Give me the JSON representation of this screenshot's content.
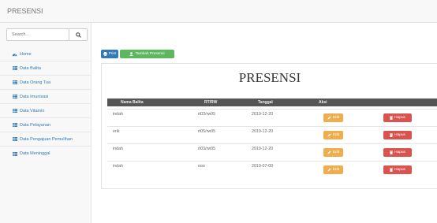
{
  "app": {
    "brand": "PRESENSI"
  },
  "search": {
    "placeholder": "Search..."
  },
  "sidebar": {
    "items": [
      {
        "label": "Home",
        "icon": "dashboard-icon"
      },
      {
        "label": "Data Balita",
        "icon": "table-icon"
      },
      {
        "label": "Data Orang Tua",
        "icon": "table-icon"
      },
      {
        "label": "Data Imunisasi",
        "icon": "table-icon"
      },
      {
        "label": "Data Vitamin",
        "icon": "table-icon"
      },
      {
        "label": "Data Pelayanan",
        "icon": "table-icon"
      },
      {
        "label": "Data Pengajuan Pemulihan",
        "icon": "table-icon"
      },
      {
        "label": "Data Meninggal",
        "icon": "table-icon"
      }
    ]
  },
  "toolbar": {
    "print_label": "Print",
    "add_label": "Tambah Presensi"
  },
  "panel": {
    "title": "PRESENSI"
  },
  "table": {
    "headers": [
      "Nama Balita",
      "RT/RW",
      "Tanggal",
      "Aksi"
    ],
    "rows": [
      {
        "nama": "indah",
        "rtrw": "rt03/rw05",
        "tanggal": "2019-12-20"
      },
      {
        "nama": "erik",
        "rtrw": "rt05/rw05",
        "tanggal": "2019-12-20"
      },
      {
        "nama": "indah",
        "rtrw": "rt03/rw05",
        "tanggal": "2019-12-20"
      },
      {
        "nama": "indah",
        "rtrw": "ooo",
        "tanggal": "2019-07-09"
      }
    ],
    "edit_label": "Edit",
    "delete_label": "Hapus"
  },
  "colors": {
    "print_button": "#337ab7",
    "add_button": "#5cb85c",
    "edit_button": "#f0ad4e",
    "delete_button": "#d9534f",
    "table_header": "#555555",
    "link": "#337ab7"
  }
}
